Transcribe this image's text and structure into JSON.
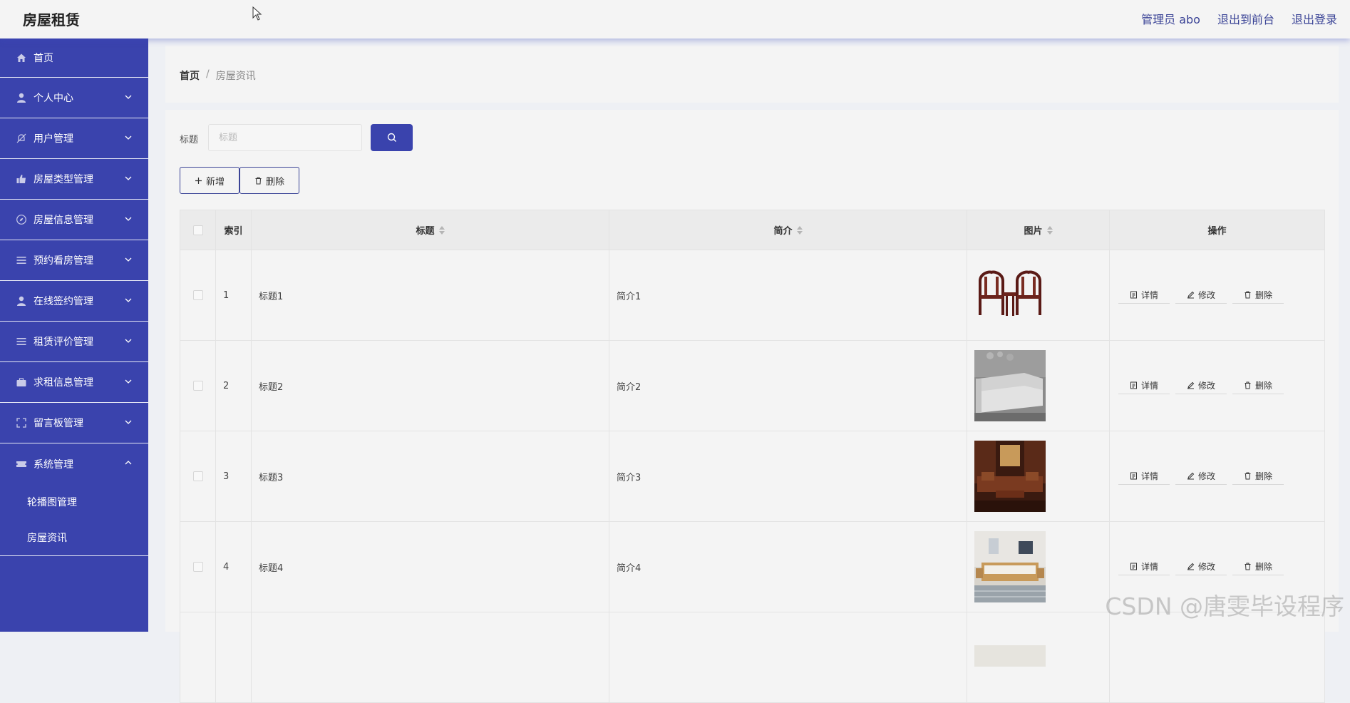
{
  "app": {
    "title": "房屋租赁"
  },
  "header": {
    "links": [
      "管理员 abo",
      "退出到前台",
      "退出登录"
    ]
  },
  "sidebar": {
    "items": [
      {
        "label": "首页",
        "icon": "home-icon",
        "expandable": false
      },
      {
        "label": "个人中心",
        "icon": "user-icon",
        "expandable": true
      },
      {
        "label": "用户管理",
        "icon": "bell-off-icon",
        "expandable": true
      },
      {
        "label": "房屋类型管理",
        "icon": "thumb-icon",
        "expandable": true
      },
      {
        "label": "房屋信息管理",
        "icon": "compass-icon",
        "expandable": true
      },
      {
        "label": "预约看房管理",
        "icon": "list-icon",
        "expandable": true
      },
      {
        "label": "在线签约管理",
        "icon": "user-icon",
        "expandable": true
      },
      {
        "label": "租赁评价管理",
        "icon": "list-icon",
        "expandable": true
      },
      {
        "label": "求租信息管理",
        "icon": "briefcase-icon",
        "expandable": true
      },
      {
        "label": "留言板管理",
        "icon": "fullscreen-icon",
        "expandable": true
      },
      {
        "label": "系统管理",
        "icon": "ticket-icon",
        "expandable": true,
        "expanded": true
      }
    ],
    "sub_items": [
      "轮播图管理",
      "房屋资讯"
    ]
  },
  "breadcrumb": {
    "home": "首页",
    "separator": "/",
    "current": "房屋资讯"
  },
  "search": {
    "label": "标题",
    "placeholder": "标题",
    "value": ""
  },
  "actions": {
    "add": "新增",
    "delete": "删除"
  },
  "table": {
    "headers": {
      "index": "索引",
      "title": "标题",
      "intro": "简介",
      "image": "图片",
      "ops": "操作"
    },
    "rows": [
      {
        "index": "1",
        "title": "标题1",
        "intro": "简介1",
        "image": "chairs"
      },
      {
        "index": "2",
        "title": "标题2",
        "intro": "简介2",
        "image": "sofa"
      },
      {
        "index": "3",
        "title": "标题3",
        "intro": "简介3",
        "image": "living-room"
      },
      {
        "index": "4",
        "title": "标题4",
        "intro": "简介4",
        "image": "bedroom"
      }
    ],
    "row_ops": {
      "detail": "详情",
      "edit": "修改",
      "delete": "删除"
    }
  },
  "watermark": "CSDN @唐雯毕设程序",
  "colors": {
    "primary": "#3a43ad",
    "link": "#3a4396"
  }
}
